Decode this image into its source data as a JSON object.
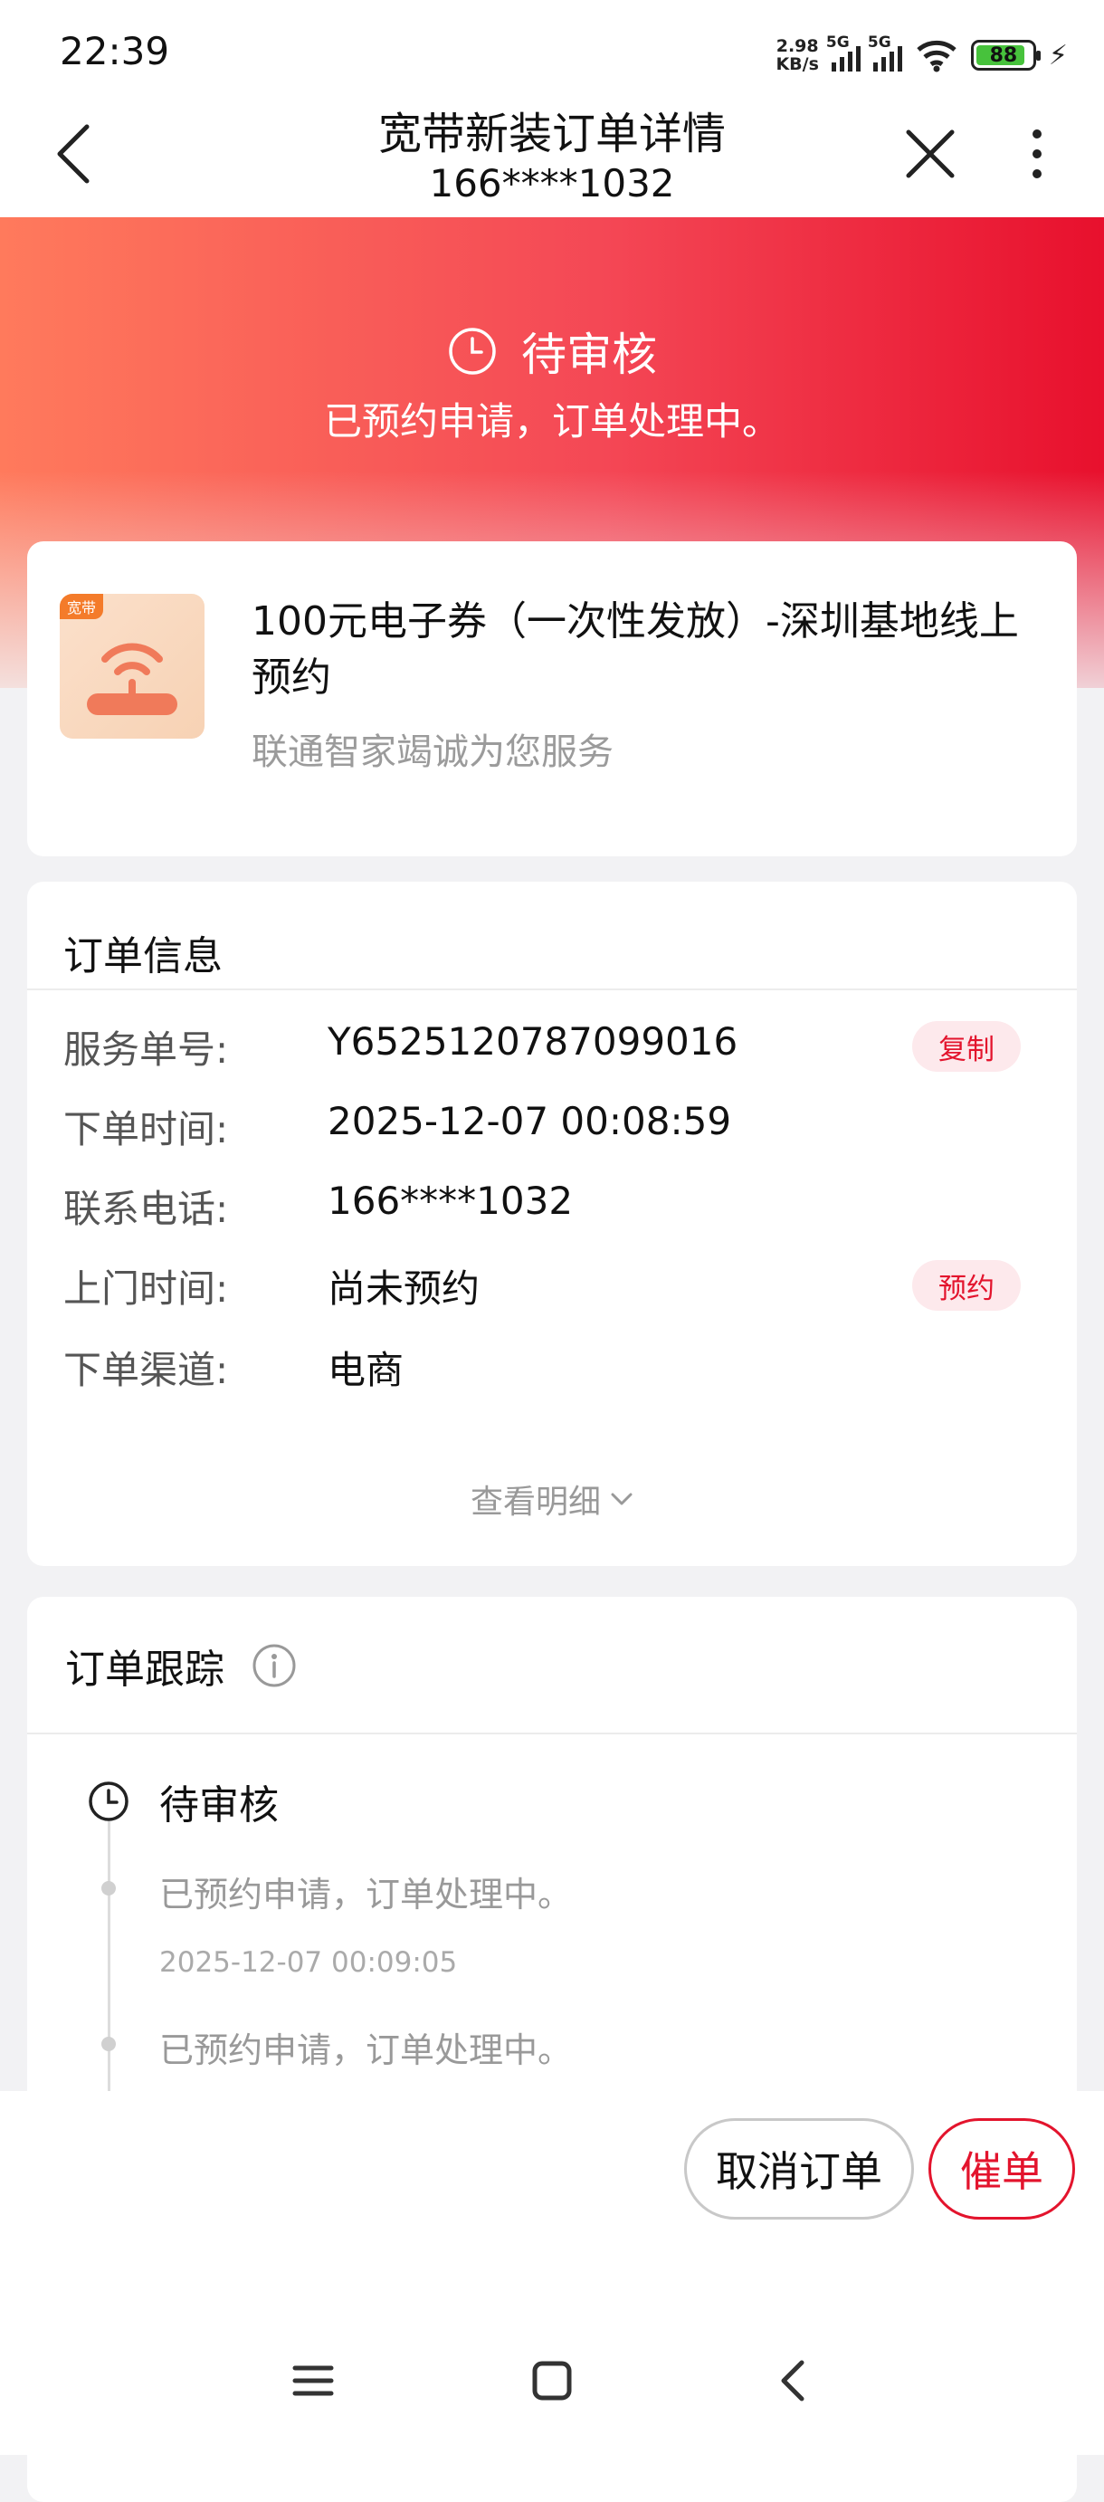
{
  "status_bar": {
    "time": "22:39",
    "net_speed_value": "2.98",
    "net_speed_unit": "KB/s",
    "signal_1_label": "5G",
    "signal_2_label": "5G",
    "battery": "88",
    "icons": [
      "signal-icon",
      "wifi-icon",
      "battery-icon",
      "charging-icon"
    ]
  },
  "nav": {
    "title": "宽带新装订单详情",
    "subtitle": "166****1032"
  },
  "hero": {
    "status": "待审核",
    "description": "已预约申请，订单处理中。"
  },
  "product": {
    "thumb_tag": "宽带",
    "name": "100元电子券（一次性发放）-深圳基地线上预约",
    "slogan": "联通智家竭诚为您服务"
  },
  "order_info": {
    "title": "订单信息",
    "rows": [
      {
        "label": "服务单号:",
        "value": "Y6525120787099016",
        "action": "复制"
      },
      {
        "label": "下单时间:",
        "value": "2025-12-07 00:08:59"
      },
      {
        "label": "联系电话:",
        "value": "166****1032"
      },
      {
        "label": "上门时间:",
        "value": "尚未预约",
        "action": "预约"
      },
      {
        "label": "下单渠道:",
        "value": "电商"
      }
    ],
    "detail_link": "查看明细"
  },
  "tracking": {
    "title": "订单跟踪",
    "status": "待审核",
    "entries": [
      {
        "text": "已预约申请，订单处理中。",
        "time": "2025-12-07 00:09:05"
      },
      {
        "text": "已预约申请，订单处理中。"
      }
    ]
  },
  "actions": {
    "cancel": "取消订单",
    "urge": "催单"
  },
  "colors": {
    "accent": "#e3142d",
    "hero_start": "#ff7a5c",
    "hero_end": "#e8102d"
  }
}
